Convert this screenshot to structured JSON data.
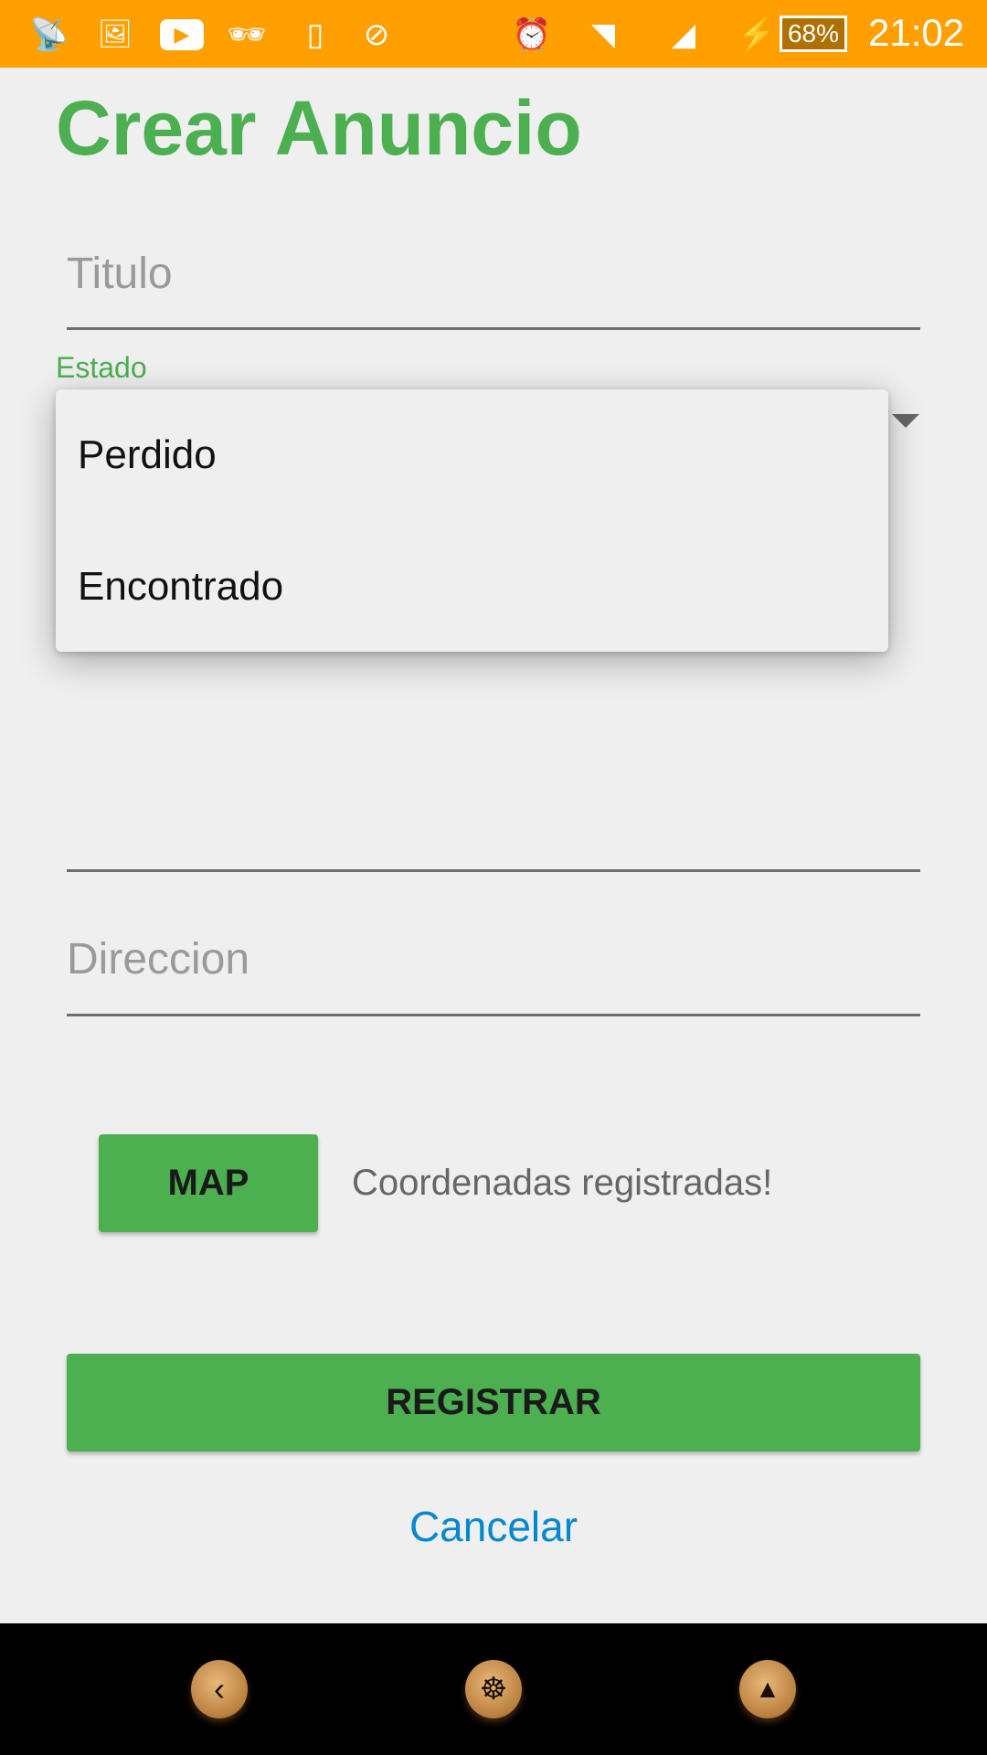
{
  "status_bar": {
    "battery": "68%",
    "time": "21:02",
    "icons": [
      "radio-tower-icon",
      "image-icon",
      "youtube-icon",
      "incognito-icon",
      "phone-sd-icon",
      "no-globe-icon",
      "alarm-icon",
      "wifi-icon",
      "signal-icon",
      "charging-icon"
    ]
  },
  "page": {
    "title": "Crear Anuncio"
  },
  "form": {
    "titulo_placeholder": "Titulo",
    "estado_label": "Estado",
    "estado_options": [
      "Perdido",
      "Encontrado"
    ],
    "direccion_placeholder": "Direccion",
    "map_button": "MAP",
    "coords_status": "Coordenadas registradas!",
    "register_button": "REGISTRAR",
    "cancel_link": "Cancelar"
  },
  "colors": {
    "accent": "#4caf50",
    "status_bar": "#ffa000",
    "link": "#0288d1"
  },
  "nav_bar": {
    "icons": [
      "back-icon",
      "home-wheel-icon",
      "recents-up-icon"
    ]
  }
}
